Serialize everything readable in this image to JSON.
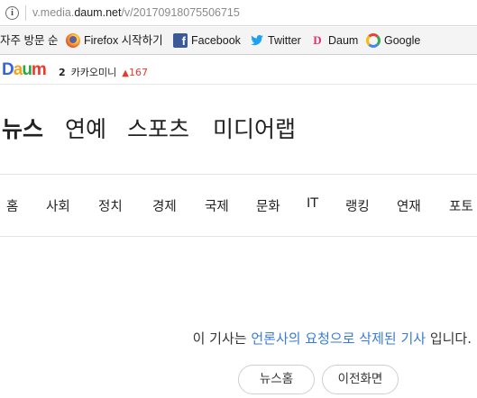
{
  "address_bar": {
    "url_prefix": "v.media.",
    "url_domain": "daum.net",
    "url_path": "/v/20170918075506715",
    "info_icon": "info-icon"
  },
  "bookmarks": {
    "items": [
      {
        "label": "자주 방문 순",
        "icon": ""
      },
      {
        "label": "Firefox 시작하기",
        "icon": "firefox-icon"
      },
      {
        "label": "Facebook",
        "icon": "facebook-icon"
      },
      {
        "label": "Twitter",
        "icon": "twitter-icon"
      },
      {
        "label": "Daum",
        "icon": "daum-icon"
      },
      {
        "label": "Google",
        "icon": "google-icon"
      }
    ]
  },
  "header": {
    "logo": {
      "d": "D",
      "a": "a",
      "u": "u",
      "m": "m"
    },
    "ranking": {
      "rank": "2",
      "keyword": "카카오미니",
      "count": "167"
    }
  },
  "gnb": [
    "뉴스",
    "연예",
    "스포츠",
    "미디어랩"
  ],
  "subnav": [
    "홈",
    "사회",
    "정치",
    "경제",
    "국제",
    "문화",
    "IT",
    "랭킹",
    "연재",
    "포토"
  ],
  "message": {
    "prefix": "이 기사는 ",
    "highlight": "언론사의 요청으로 삭제된 기사",
    "suffix": " 입니다."
  },
  "buttons": {
    "news_home": "뉴스홈",
    "previous": "이전화면"
  },
  "colors": {
    "highlight": "#3a7bd5",
    "ranking_up": "#e8392b",
    "facebook": "#3b5998",
    "twitter": "#1da1f2"
  }
}
